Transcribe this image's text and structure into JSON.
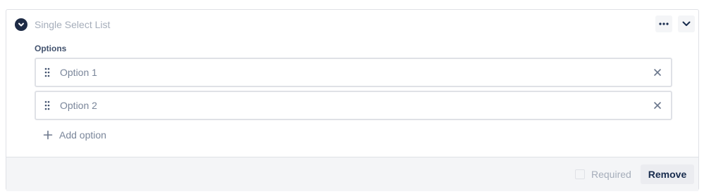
{
  "field": {
    "title": "Single Select List",
    "type_icon": "chevron-down-circle-icon"
  },
  "header_actions": {
    "more_icon": "ellipsis-icon",
    "collapse_icon": "chevron-down-icon"
  },
  "options": {
    "label": "Options",
    "items": [
      {
        "label": "Option 1"
      },
      {
        "label": "Option 2"
      }
    ],
    "add_label": "Add option"
  },
  "footer": {
    "required_label": "Required",
    "required_checked": false,
    "remove_label": "Remove"
  },
  "colors": {
    "accent_dark": "#1e2b45",
    "muted_text": "#a5adba",
    "border": "#dfe1e6",
    "footer_bg": "#f4f5f7"
  }
}
